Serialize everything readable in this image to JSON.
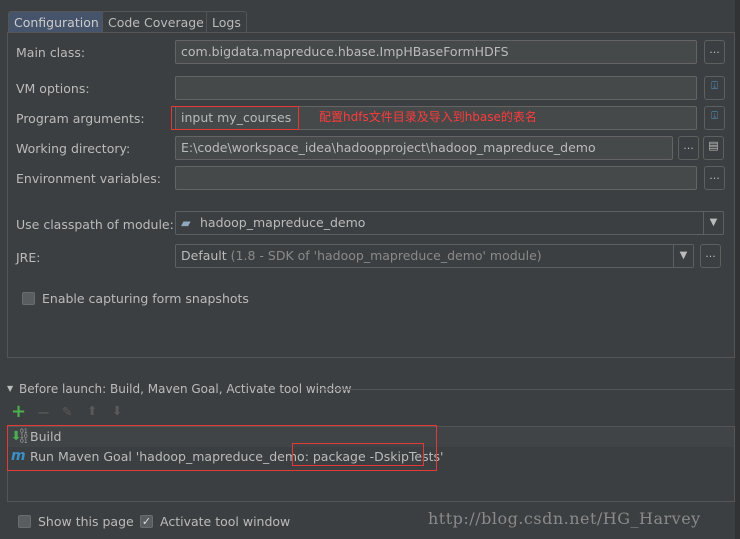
{
  "tabs": [
    {
      "label": "Configuration",
      "selected": true
    },
    {
      "label": "Code Coverage"
    },
    {
      "label": "Logs"
    }
  ],
  "form": {
    "main_class": {
      "label": "Main class:",
      "value": "com.bigdata.mapreduce.hbase.ImpHBaseFormHDFS"
    },
    "vm_options": {
      "label": "VM options:",
      "value": ""
    },
    "program_arguments": {
      "label": "Program arguments:",
      "value": "input my_courses"
    },
    "working_directory": {
      "label": "Working directory:",
      "value": "E:\\code\\workspace_idea\\hadoopproject\\hadoop_mapreduce_demo"
    },
    "environment_variables": {
      "label": "Environment variables:",
      "value": ""
    },
    "classpath_module": {
      "label": "Use classpath of module:",
      "value": "hadoop_mapreduce_demo"
    },
    "jre": {
      "label": "JRE:",
      "value": "Default",
      "detail": "(1.8 - SDK of 'hadoop_mapreduce_demo' module)"
    },
    "snapshots": {
      "label": "Enable capturing form snapshots",
      "checked": false
    },
    "ellipsis": "..."
  },
  "annotation": "配置hdfs文件目录及导入到hbase的表名",
  "before_launch": {
    "title": "Before launch: Build, Maven Goal, Activate tool window",
    "items": [
      {
        "label": "Build",
        "icon": "build-icon"
      },
      {
        "label": "Run Maven Goal 'hadoop_mapreduce_demo: ",
        "highlight": "package -DskipTests'",
        "icon": "maven-icon"
      }
    ]
  },
  "footer": {
    "show_page": {
      "label": "Show this page",
      "checked": false
    },
    "activate_tool": {
      "label": "Activate tool window",
      "checked": true
    }
  },
  "watermark": "http://blog.csdn.net/HG_Harvey",
  "colors": {
    "accent_red": "#e53935",
    "selected_tab": "#45546b",
    "add_green": "#4caf50"
  }
}
